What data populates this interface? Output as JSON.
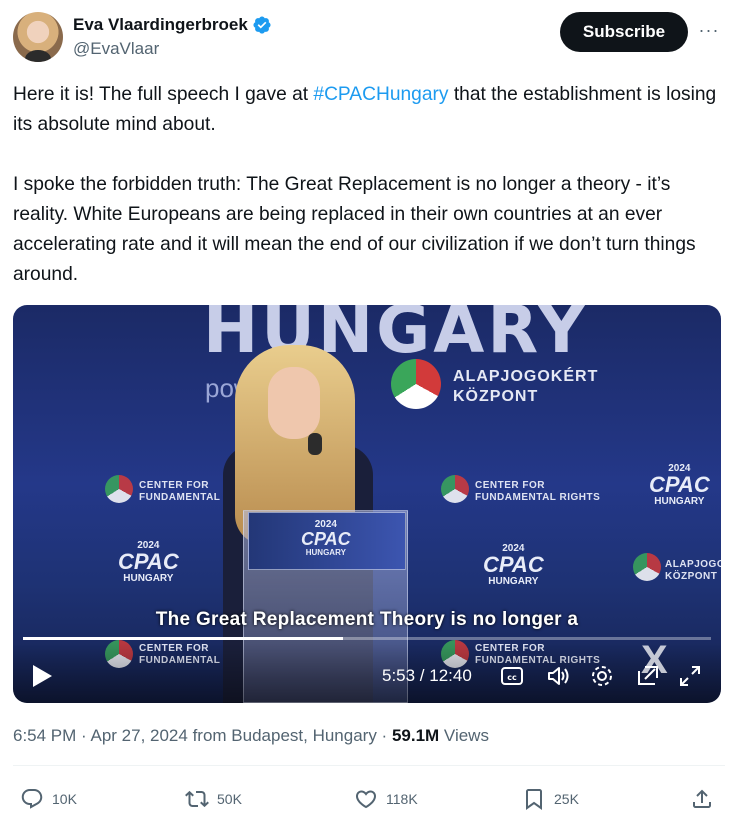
{
  "author": {
    "display_name": "Eva Vlaardingerbroek",
    "handle": "@EvaVlaar"
  },
  "header": {
    "subscribe_label": "Subscribe",
    "more_label": "···"
  },
  "tweet": {
    "text_before_hashtag": "Here it is! The full speech I gave at ",
    "hashtag": "#CPACHungary",
    "text_after_hashtag": " that the establishment is losing its absolute mind about.",
    "paragraph_2": "I spoke the forbidden truth: The Great Replacement is no longer a theory - it’s reality. White Europeans are being replaced in their own countries at an ever accelerating rate and it will mean the end of our civilization if we don’t turn things around."
  },
  "video": {
    "banner_top": "HUNGARY",
    "banner_power": "pow          y",
    "alap_line1": "ALAPJOGOKÉRT",
    "alap_line2": "KÖZPONT",
    "center_line1": "CENTER FOR",
    "center_line2": "FUNDAMENTAL RIGHTS",
    "center_line2_short": "FUNDAMENTAL",
    "cpac_year": "2024",
    "cpac_word": "CPAC",
    "cpac_country": "HUNGARY",
    "subtitle": "The Great Replacement Theory is no longer a",
    "time_display": "5:53 / 12:40",
    "progress_fraction": 0.465,
    "watermark": "X"
  },
  "meta": {
    "time": "6:54 PM",
    "sep1": " · ",
    "date": "Apr 27, 2024",
    "location": " from Budapest, Hungary",
    "sep2": " · ",
    "views_count": "59.1M",
    "views_label": " Views"
  },
  "actions": {
    "replies": "10K",
    "reposts": "50K",
    "likes": "118K",
    "bookmarks": "25K"
  },
  "colors": {
    "accent": "#1d9bf0",
    "text": "#0f1419",
    "muted": "#536471"
  }
}
